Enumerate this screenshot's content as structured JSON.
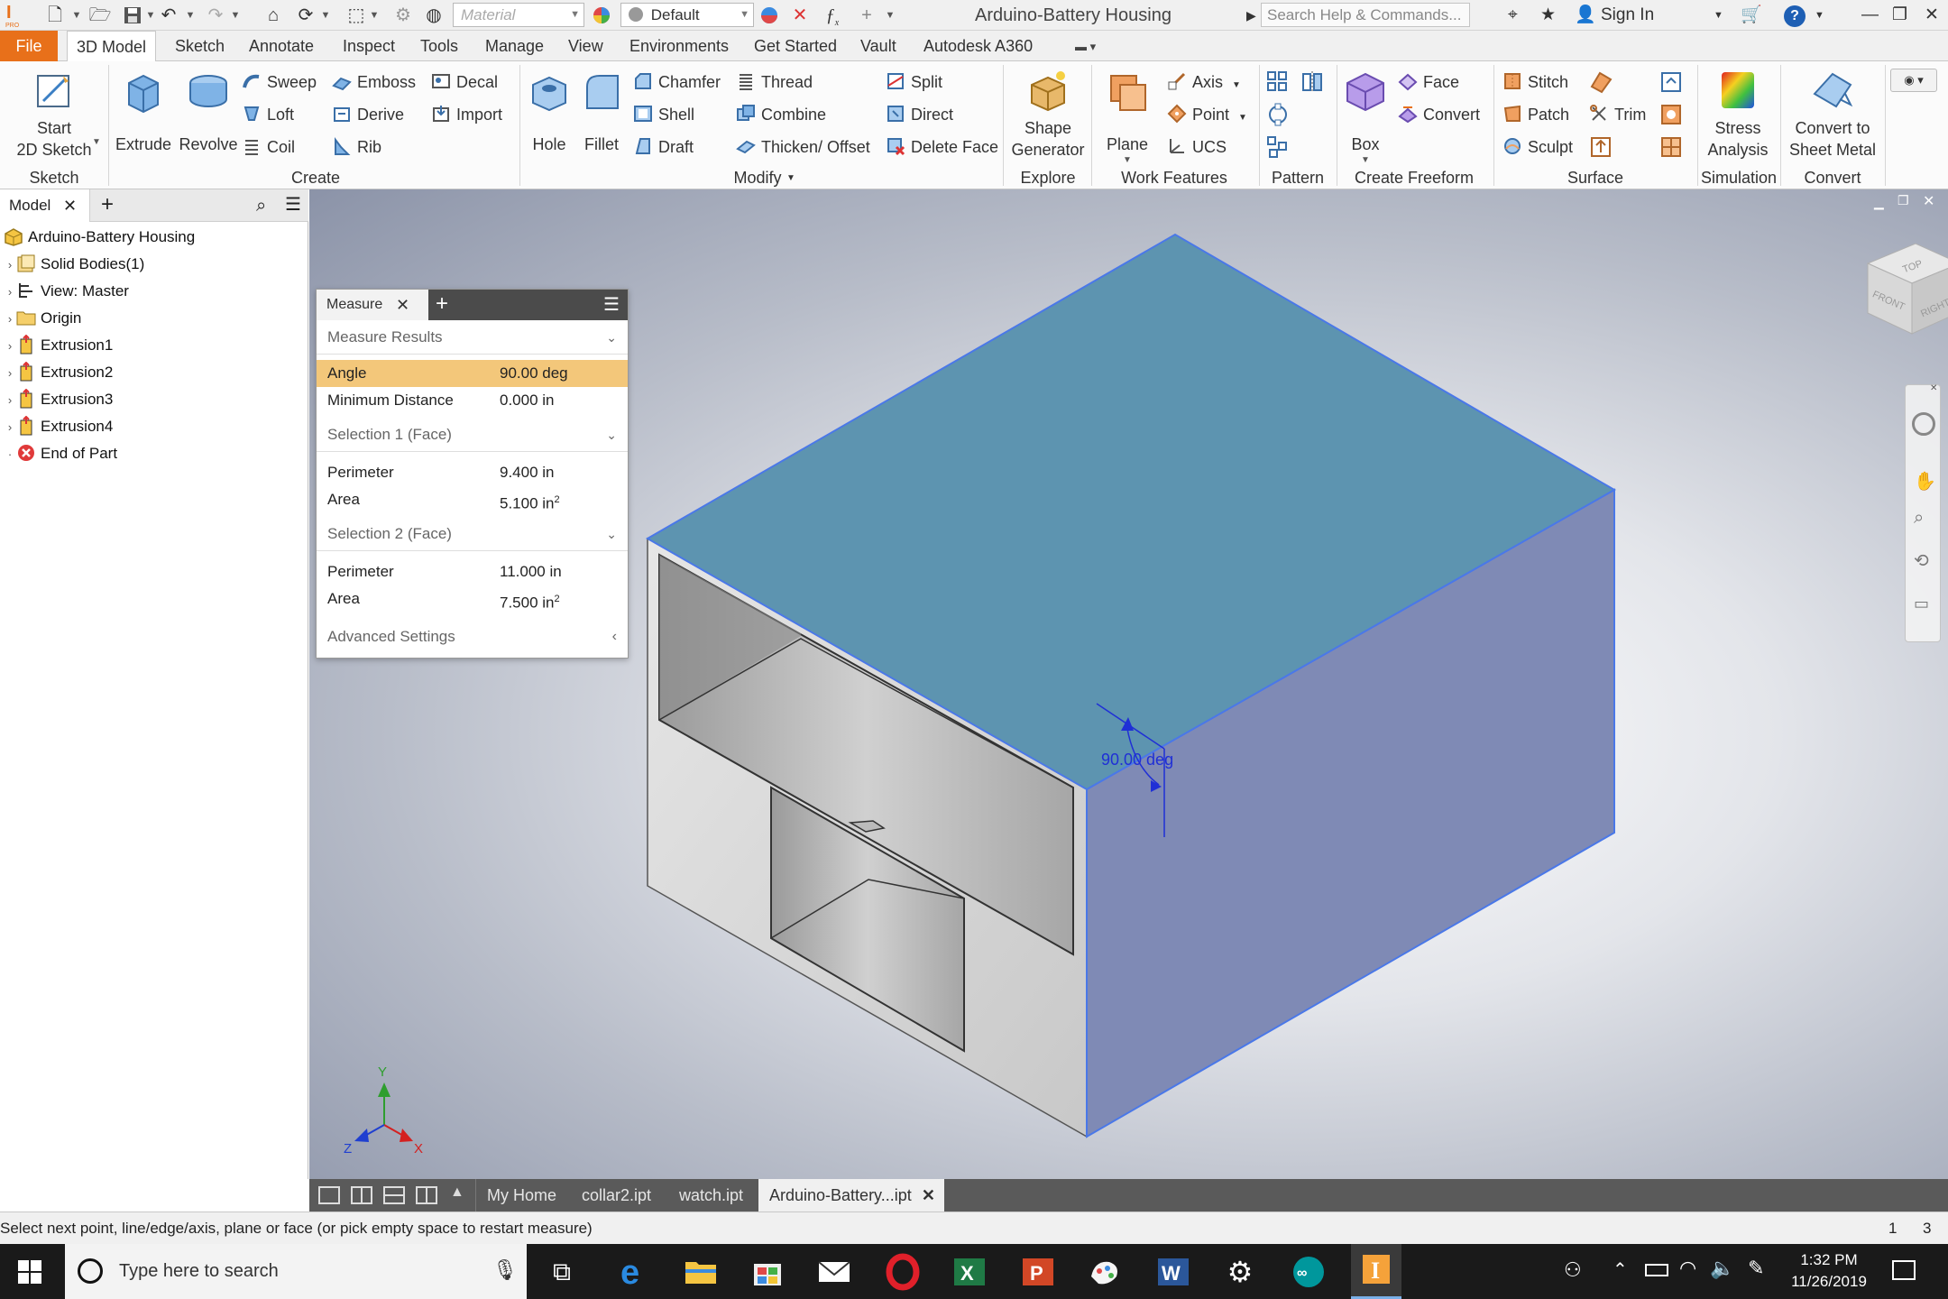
{
  "window": {
    "title": "Arduino-Battery Housing",
    "material_placeholder": "Material",
    "appearance": "Default",
    "search_placeholder": "Search Help & Commands...",
    "sign_in": "Sign In"
  },
  "tabs": [
    "File",
    "3D Model",
    "Sketch",
    "Annotate",
    "Inspect",
    "Tools",
    "Manage",
    "View",
    "Environments",
    "Get Started",
    "Vault",
    "Autodesk A360"
  ],
  "ribbon": {
    "sketch": {
      "start_line1": "Start",
      "start_line2": "2D Sketch",
      "group": "Sketch"
    },
    "create": {
      "extrude": "Extrude",
      "revolve": "Revolve",
      "sweep": "Sweep",
      "emboss": "Emboss",
      "decal": "Decal",
      "loft": "Loft",
      "derive": "Derive",
      "import": "Import",
      "coil": "Coil",
      "rib": "Rib",
      "group": "Create"
    },
    "modify": {
      "hole": "Hole",
      "fillet": "Fillet",
      "chamfer": "Chamfer",
      "thread": "Thread",
      "split": "Split",
      "shell": "Shell",
      "combine": "Combine",
      "direct": "Direct",
      "draft": "Draft",
      "thicken": "Thicken/ Offset",
      "delete_face": "Delete Face",
      "group": "Modify"
    },
    "explore": {
      "shape_line1": "Shape",
      "shape_line2": "Generator",
      "group": "Explore"
    },
    "work_features": {
      "plane": "Plane",
      "axis": "Axis",
      "point": "Point",
      "ucs": "UCS",
      "group": "Work Features"
    },
    "pattern": {
      "group": "Pattern"
    },
    "freeform": {
      "box": "Box",
      "face": "Face",
      "convert": "Convert",
      "group": "Create Freeform"
    },
    "surface": {
      "stitch": "Stitch",
      "patch": "Patch",
      "trim": "Trim",
      "sculpt": "Sculpt",
      "group": "Surface"
    },
    "simulation": {
      "stress_line1": "Stress",
      "stress_line2": "Analysis",
      "group": "Simulation"
    },
    "convert": {
      "sheet_line1": "Convert to",
      "sheet_line2": "Sheet Metal",
      "group": "Convert"
    }
  },
  "browser": {
    "tab": "Model",
    "items": [
      {
        "label": "Arduino-Battery Housing",
        "icon": "part-icon"
      },
      {
        "label": "Solid Bodies(1)",
        "icon": "solid-bodies-icon"
      },
      {
        "label": "View: Master",
        "icon": "view-icon"
      },
      {
        "label": "Origin",
        "icon": "folder-icon"
      },
      {
        "label": "Extrusion1",
        "icon": "extrusion-icon"
      },
      {
        "label": "Extrusion2",
        "icon": "extrusion-icon"
      },
      {
        "label": "Extrusion3",
        "icon": "extrusion-icon"
      },
      {
        "label": "Extrusion4",
        "icon": "extrusion-icon"
      },
      {
        "label": "End of Part",
        "icon": "end-of-part-icon"
      }
    ]
  },
  "measure": {
    "tab": "Measure",
    "results_header": "Measure Results",
    "angle_label": "Angle",
    "angle_value": "90.00 deg",
    "min_dist_label": "Minimum Distance",
    "min_dist_value": "0.000 in",
    "sel1_header": "Selection 1 (Face)",
    "sel1_perimeter_label": "Perimeter",
    "sel1_perimeter_value": "9.400 in",
    "sel1_area_label": "Area",
    "sel1_area_value": "5.100 in",
    "sel2_header": "Selection 2 (Face)",
    "sel2_perimeter_label": "Perimeter",
    "sel2_perimeter_value": "11.000 in",
    "sel2_area_label": "Area",
    "sel2_area_value": "7.500 in",
    "area_exponent": "2",
    "advanced": "Advanced Settings"
  },
  "viewport": {
    "angle_annotation": "90.00 deg",
    "viewcube_top": "TOP",
    "viewcube_front": "FRONT",
    "viewcube_right": "RIGHT",
    "axis_x": "X",
    "axis_y": "Y",
    "axis_z": "Z"
  },
  "doc_tabs": [
    "My Home",
    "collar2.ipt",
    "watch.ipt",
    "Arduino-Battery...ipt"
  ],
  "status": {
    "message": "Select next point, line/edge/axis, plane or face (or pick empty space to restart measure)",
    "num1": "1",
    "num2": "3"
  },
  "taskbar": {
    "search_placeholder": "Type here to search",
    "time": "1:32 PM",
    "date": "11/26/2019"
  },
  "colors": {
    "accent": "#e8701a",
    "highlight_row": "#f3c77a",
    "selected_face_top": "#5d94b0",
    "selected_face_side": "#7f8ab5",
    "dimension": "#1f2fd6"
  }
}
